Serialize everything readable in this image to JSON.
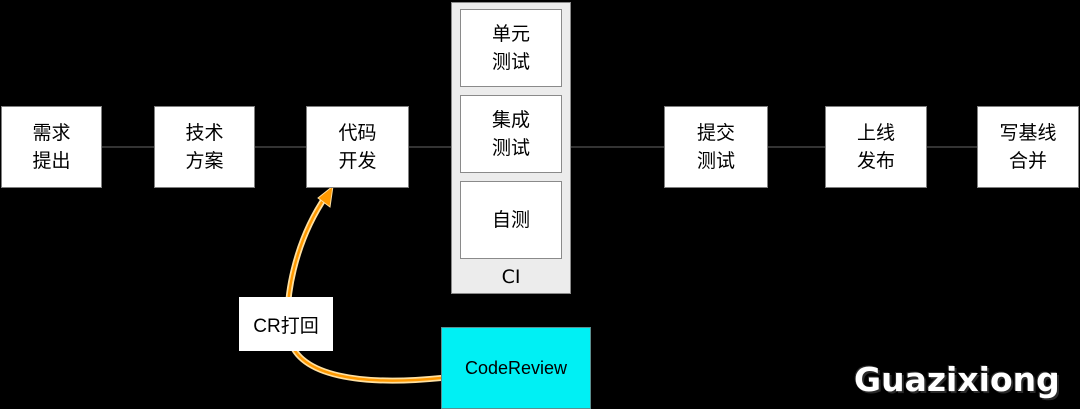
{
  "nodes": {
    "requirement": "需求\n提出",
    "tech_plan": "技术\n方案",
    "code_dev": "代码\n开发",
    "submit_test": "提交\n测试",
    "release": "上线\n发布",
    "merge": "写基线\n合并"
  },
  "ci": {
    "label": "CI",
    "unit_test": "单元\n测试",
    "integration_test": "集成\n测试",
    "self_test": "自测"
  },
  "code_review": {
    "label": "CodeReview",
    "reject_label": "CR打回"
  },
  "watermark": "Guazixiong",
  "colors": {
    "background": "#000000",
    "node_fill": "#ffffff",
    "ci_fill": "#ececec",
    "code_review_fill": "#00f0f4",
    "arrow_stroke": "#ff9900",
    "arrow_glow": "#ffe0a0"
  }
}
